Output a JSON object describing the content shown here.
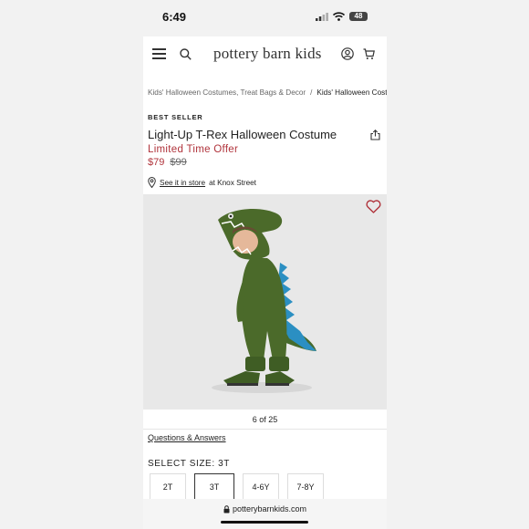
{
  "status": {
    "time": "6:49",
    "battery": "48"
  },
  "nav": {
    "brand": "pottery barn kids"
  },
  "breadcrumb": {
    "items": [
      "Kids' Halloween Costumes, Treat Bags & Decor",
      "Kids' Halloween Costumes"
    ],
    "separator": "/"
  },
  "product": {
    "badge": "BEST SELLER",
    "title": "Light-Up T-Rex Halloween Costume",
    "promo": "Limited Time Offer",
    "sale_price": "$79",
    "original_price": "$99",
    "store_link": "See it in store",
    "store_suffix": "at Knox Street"
  },
  "gallery": {
    "counter": "6 of 25"
  },
  "links": {
    "qa": "Questions & Answers"
  },
  "size": {
    "label": "SELECT SIZE:",
    "selected": "3T",
    "options": [
      "2T",
      "3T",
      "4-6Y",
      "7-8Y"
    ]
  },
  "browser": {
    "url": "potterybarnkids.com"
  },
  "colors": {
    "accent_red": "#b0333b",
    "costume_green": "#4b6a2a",
    "spikes_blue": "#2b8fc2"
  },
  "icons": [
    "menu-icon",
    "search-icon",
    "account-icon",
    "cart-icon",
    "share-icon",
    "location-pin-icon",
    "heart-icon",
    "lock-icon"
  ]
}
